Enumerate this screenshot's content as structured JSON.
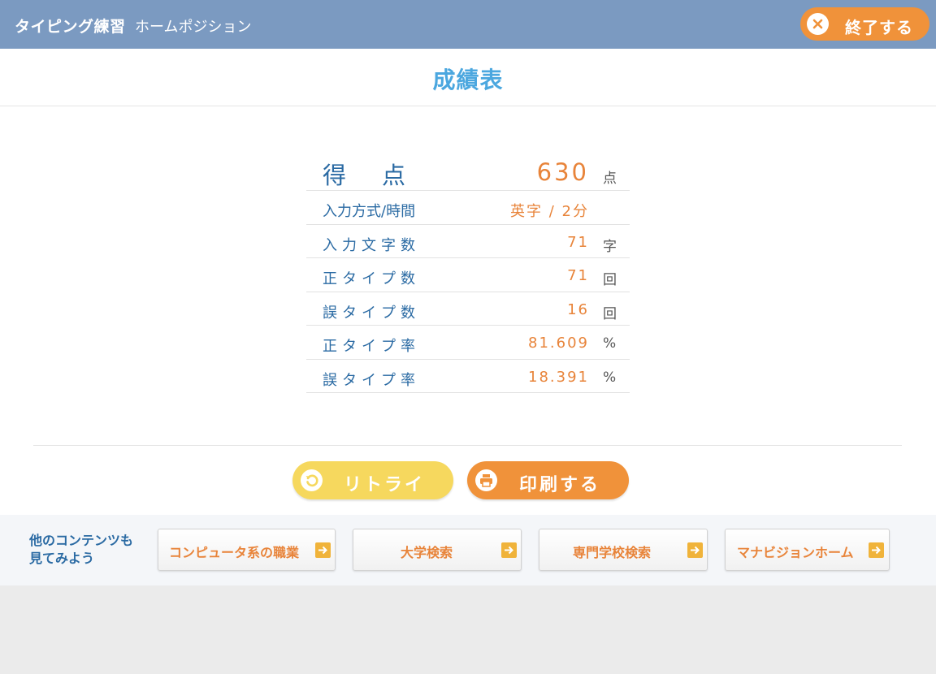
{
  "header": {
    "app_title": "タイピング練習",
    "sub_title": "ホームポジション",
    "quit_label": "終了する",
    "quit_icon": "close-icon"
  },
  "main": {
    "page_title": "成績表",
    "rows": [
      {
        "label": "得点",
        "value": "630",
        "unit": "点"
      },
      {
        "label": "入力方式/時間",
        "value": "英字 / 2分",
        "unit": ""
      },
      {
        "label": "入力文字数",
        "value": "71",
        "unit": "字"
      },
      {
        "label": "正タイプ数",
        "value": "71",
        "unit": "回"
      },
      {
        "label": "誤タイプ数",
        "value": "16",
        "unit": "回"
      },
      {
        "label": "正タイプ率",
        "value": "81.609",
        "unit": "%"
      },
      {
        "label": "誤タイプ率",
        "value": "18.391",
        "unit": "%"
      }
    ],
    "retry_label": "リトライ",
    "print_label": "印刷する"
  },
  "footer": {
    "others_line1": "他のコンテンツも",
    "others_line2": "見てみよう",
    "links": [
      {
        "label": "コンピュータ系の職業"
      },
      {
        "label": "大学検索"
      },
      {
        "label": "専門学校検索"
      },
      {
        "label": "マナビジョンホーム"
      }
    ]
  },
  "colors": {
    "header_bg": "#7b9ac1",
    "accent_orange": "#f0923a",
    "retry_yellow": "#f6d85e",
    "title_blue": "#4ba7df",
    "label_blue": "#2a6aa3",
    "value_orange": "#e8843a"
  }
}
